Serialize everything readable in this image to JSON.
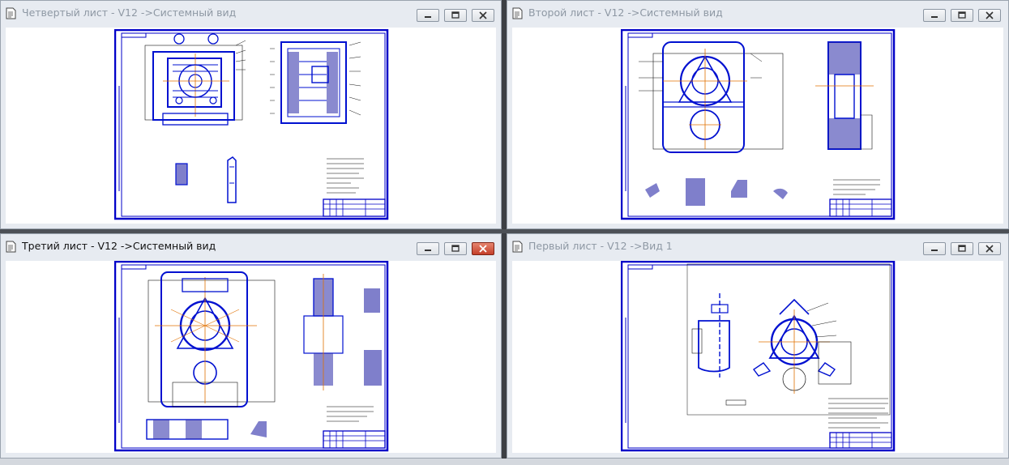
{
  "windows": [
    {
      "id": "w4",
      "title": "Четвертый лист - V12 ->Системный вид",
      "active": false
    },
    {
      "id": "w2",
      "title": "Второй лист - V12 ->Системный вид",
      "active": false
    },
    {
      "id": "w3",
      "title": "Третий лист - V12 ->Системный вид",
      "active": true
    },
    {
      "id": "w1",
      "title": "Первый лист - V12 ->Вид 1",
      "active": false
    }
  ],
  "colors": {
    "frame": "#0000c8",
    "geometry": "#0010d0",
    "axis": "#e07000",
    "thin": "#111111",
    "accent": "#20a0a0"
  },
  "icons": [
    "document-icon",
    "minimize-icon",
    "maximize-icon",
    "close-icon"
  ]
}
